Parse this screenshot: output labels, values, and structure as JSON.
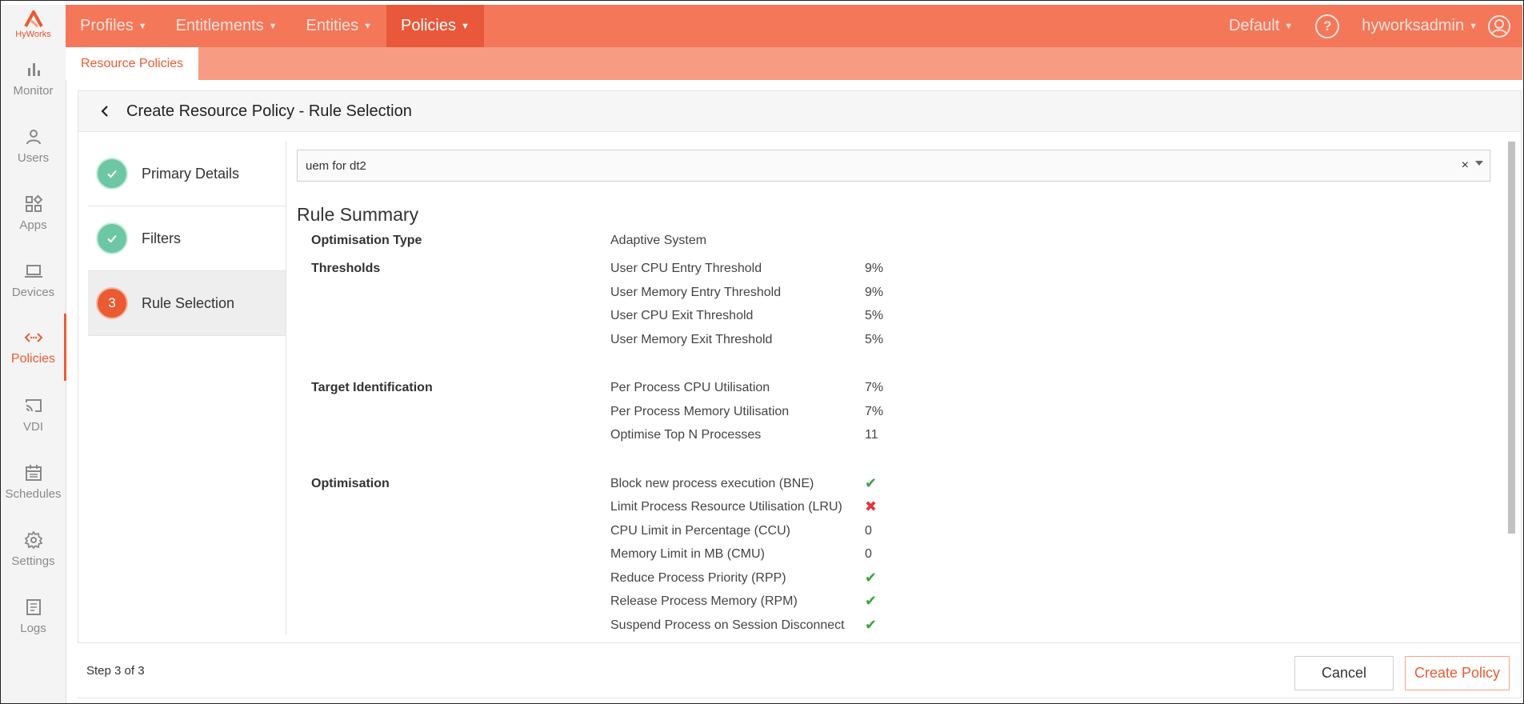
{
  "app": {
    "logo_text": "HyWorks"
  },
  "sidebar": {
    "items": [
      {
        "label": "Monitor",
        "icon": "bar-chart-icon"
      },
      {
        "label": "Users",
        "icon": "user-icon"
      },
      {
        "label": "Apps",
        "icon": "apps-icon"
      },
      {
        "label": "Devices",
        "icon": "laptop-icon"
      },
      {
        "label": "Policies",
        "icon": "code-arrows-icon",
        "active": true
      },
      {
        "label": "VDI",
        "icon": "cast-icon"
      },
      {
        "label": "Schedules",
        "icon": "calendar-icon"
      },
      {
        "label": "Settings",
        "icon": "gear-icon"
      },
      {
        "label": "Logs",
        "icon": "document-icon"
      }
    ]
  },
  "topbar": {
    "menus": [
      "Profiles",
      "Entitlements",
      "Entities",
      "Policies"
    ],
    "active_menu": "Policies",
    "tenant": "Default",
    "user": "hyworksadmin"
  },
  "subnav": {
    "tab": "Resource Policies"
  },
  "page": {
    "title": "Create Resource Policy - Rule Selection"
  },
  "steps": [
    {
      "label": "Primary Details",
      "status": "done"
    },
    {
      "label": "Filters",
      "status": "done"
    },
    {
      "label": "Rule Selection",
      "status": "current",
      "number": "3"
    }
  ],
  "rule_select": {
    "value": "uem for dt2",
    "clear": "×"
  },
  "summary": {
    "title": "Rule Summary",
    "optimisation_type": {
      "label": "Optimisation Type",
      "value": "Adaptive System"
    },
    "thresholds": {
      "label": "Thresholds",
      "rows": [
        {
          "name": "User CPU Entry Threshold",
          "value": "9%"
        },
        {
          "name": "User Memory Entry Threshold",
          "value": "9%"
        },
        {
          "name": "User CPU Exit Threshold",
          "value": "5%"
        },
        {
          "name": "User Memory Exit Threshold",
          "value": "5%"
        }
      ]
    },
    "target": {
      "label": "Target Identification",
      "rows": [
        {
          "name": "Per Process CPU Utilisation",
          "value": "7%"
        },
        {
          "name": "Per Process Memory Utilisation",
          "value": "7%"
        },
        {
          "name": "Optimise Top N Processes",
          "value": "11"
        }
      ]
    },
    "optimisation": {
      "label": "Optimisation",
      "rows": [
        {
          "name": "Block new process execution (BNE)",
          "value": "✔"
        },
        {
          "name": "Limit Process Resource Utilisation (LRU)",
          "value": "✖"
        },
        {
          "name": "CPU Limit in Percentage (CCU)",
          "value": "0"
        },
        {
          "name": "Memory Limit in MB (CMU)",
          "value": "0"
        },
        {
          "name": "Reduce Process Priority (RPP)",
          "value": "✔"
        },
        {
          "name": "Release Process Memory (RPM)",
          "value": "✔"
        },
        {
          "name": "Suspend Process on Session Disconnect",
          "value": "✔"
        }
      ]
    }
  },
  "footer": {
    "step_text": "Step 3 of 3",
    "cancel_label": "Cancel",
    "create_label": "Create Policy"
  },
  "colors": {
    "brand": "#ea5b33",
    "topbar": "#f4775a",
    "subbar": "#f79b82",
    "done": "#6dc7a5"
  }
}
